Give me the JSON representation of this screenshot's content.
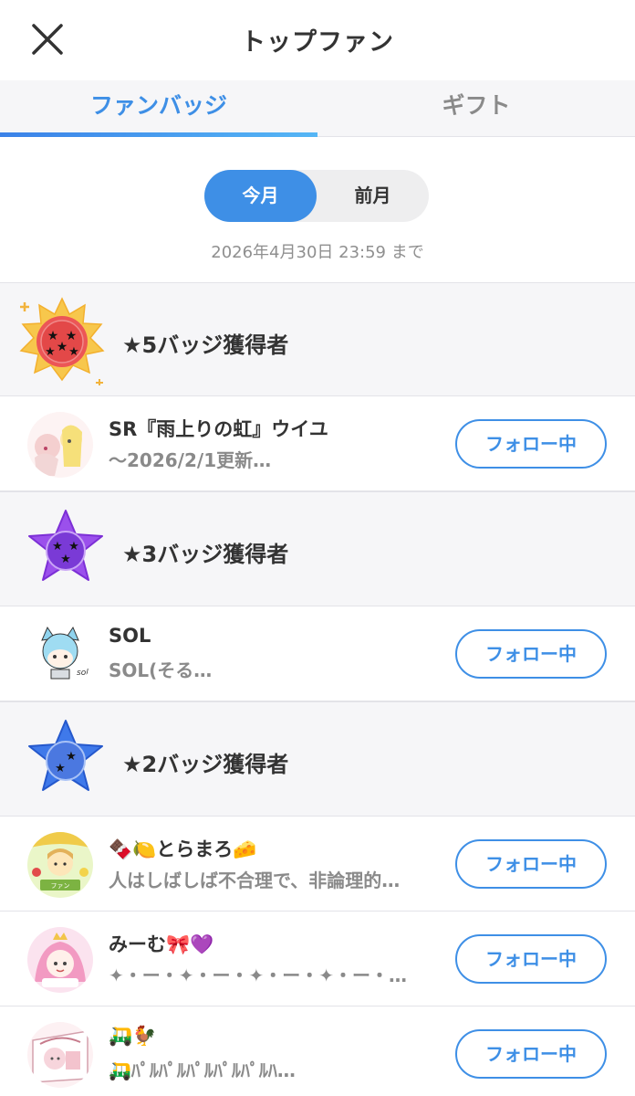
{
  "header": {
    "title": "トップファン"
  },
  "tabs": [
    {
      "label": "ファンバッジ",
      "active": true
    },
    {
      "label": "ギフト",
      "active": false
    }
  ],
  "period": {
    "current": "今月",
    "previous": "前月",
    "selected": "今月"
  },
  "deadline": "2026年4月30日 23:59 まで",
  "colors": {
    "accent": "#3e8fe6",
    "badge5": "#f2a11f",
    "badge3": "#8e44e2",
    "badge2": "#3b6fe0"
  },
  "sections": [
    {
      "label": "★5バッジ獲得者",
      "badge_icon": "five-star-badge-icon",
      "fans": [
        {
          "name": "SR『雨上りの虹』ウイユ",
          "desc": "〜2026/2/1更新…",
          "follow_label": "フォロー中"
        }
      ]
    },
    {
      "label": "★3バッジ獲得者",
      "badge_icon": "three-star-badge-icon",
      "fans": [
        {
          "name": "SOL",
          "desc": "SOL(そる…",
          "follow_label": "フォロー中"
        }
      ]
    },
    {
      "label": "★2バッジ獲得者",
      "badge_icon": "two-star-badge-icon",
      "fans": [
        {
          "name": "🍫🍋とらまろ🧀",
          "desc": "人はしばしば不合理で、非論理的…",
          "follow_label": "フォロー中"
        },
        {
          "name": "みーむ🎀💜",
          "desc": "✦・ー・✦・ー・✦・ー・✦・ー・…",
          "follow_label": "フォロー中"
        },
        {
          "name": "🛺🐓",
          "desc": "🛺ﾊﾟﾙﾊﾟﾙﾊﾟﾙﾊﾟﾙﾊﾟﾙﾊ…",
          "follow_label": "フォロー中"
        }
      ]
    }
  ]
}
